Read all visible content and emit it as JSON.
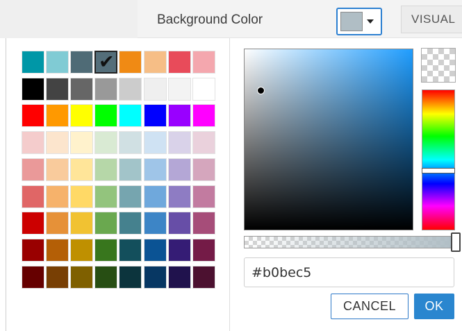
{
  "toolbar": {
    "background_color_label": "Background Color",
    "current_color": "#b0bec5",
    "visual_tab_label": "VISUAL"
  },
  "palette": {
    "selected": "#546e7a",
    "rows": [
      [
        "#0097a7",
        "#80cbd4",
        "#4f6b76",
        "#546e7a",
        "#f08a14",
        "#f6be86",
        "#e84b5a",
        "#f4a7ae"
      ],
      [
        "#000000",
        "#434343",
        "#666666",
        "#999999",
        "#cccccc",
        "#efefef",
        "#f3f3f3",
        "#ffffff"
      ],
      [
        "#ff0000",
        "#ff9900",
        "#ffff00",
        "#00ff00",
        "#00ffff",
        "#0000ff",
        "#9900ff",
        "#ff00ff"
      ],
      [
        "#f4cccc",
        "#fce5cd",
        "#fff2cc",
        "#d9ead3",
        "#d0e0e3",
        "#cfe2f3",
        "#d9d2e9",
        "#ead1dc"
      ],
      [
        "#ea9999",
        "#f9cb9c",
        "#ffe599",
        "#b6d7a8",
        "#a2c4c9",
        "#9fc5e8",
        "#b4a7d6",
        "#d5a6bd"
      ],
      [
        "#e06666",
        "#f6b26b",
        "#ffd966",
        "#93c47d",
        "#76a5af",
        "#6fa8dc",
        "#8e7cc3",
        "#c27ba0"
      ],
      [
        "#cc0000",
        "#e69138",
        "#f1c232",
        "#6aa84f",
        "#45818e",
        "#3d85c6",
        "#674ea7",
        "#a64d79"
      ],
      [
        "#990000",
        "#b45f06",
        "#bf9000",
        "#38761d",
        "#134f5c",
        "#0b5394",
        "#351c75",
        "#741b47"
      ],
      [
        "#660000",
        "#783f04",
        "#7f6000",
        "#274e13",
        "#0c343d",
        "#073763",
        "#20124d",
        "#4c1130"
      ]
    ]
  },
  "picker": {
    "hue_color": "#1f9dff",
    "hue_fraction": 0.57,
    "saturation": 0.1,
    "brightness": 0.77,
    "alpha": 1.0,
    "hex_value": "#b0bec5",
    "cancel_label": "CANCEL",
    "ok_label": "OK"
  }
}
